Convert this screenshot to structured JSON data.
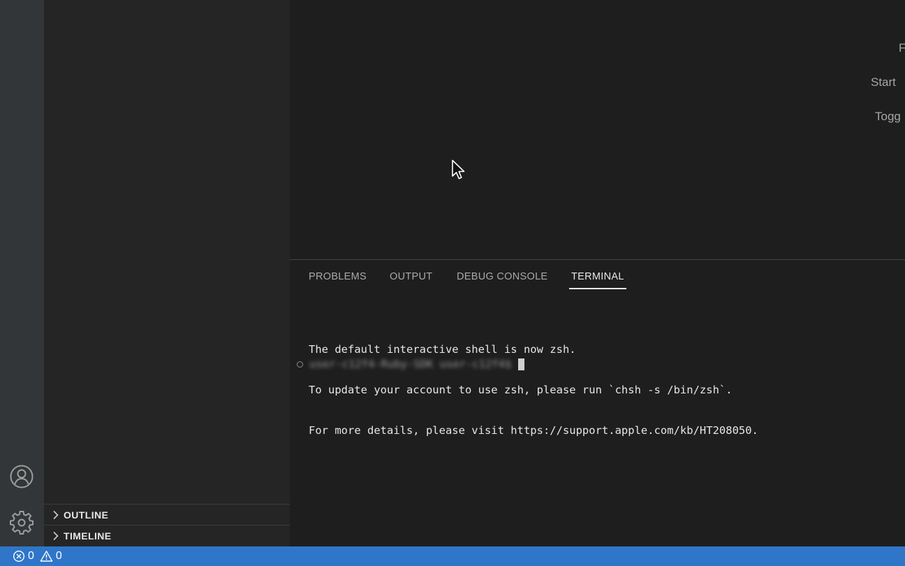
{
  "editor": {
    "hints": [
      "F",
      "Start",
      "Togg"
    ]
  },
  "sidebar": {
    "sections": [
      {
        "label": "OUTLINE"
      },
      {
        "label": "TIMELINE"
      }
    ]
  },
  "activity_bar": {
    "icons": [
      "account-icon",
      "gear-icon"
    ]
  },
  "panel": {
    "tabs": [
      {
        "label": "PROBLEMS"
      },
      {
        "label": "OUTPUT"
      },
      {
        "label": "DEBUG CONSOLE"
      },
      {
        "label": "TERMINAL"
      }
    ],
    "active_tab": "TERMINAL"
  },
  "terminal": {
    "lines": [
      "The default interactive shell is now zsh.",
      "To update your account to use zsh, please run `chsh -s /bin/zsh`.",
      "For more details, please visit https://support.apple.com/kb/HT208050."
    ],
    "prompt": "user-c12f4-Ruby-SDK user-c12f4$"
  },
  "status_bar": {
    "errors": "0",
    "warnings": "0",
    "background": "#2f76c9"
  }
}
